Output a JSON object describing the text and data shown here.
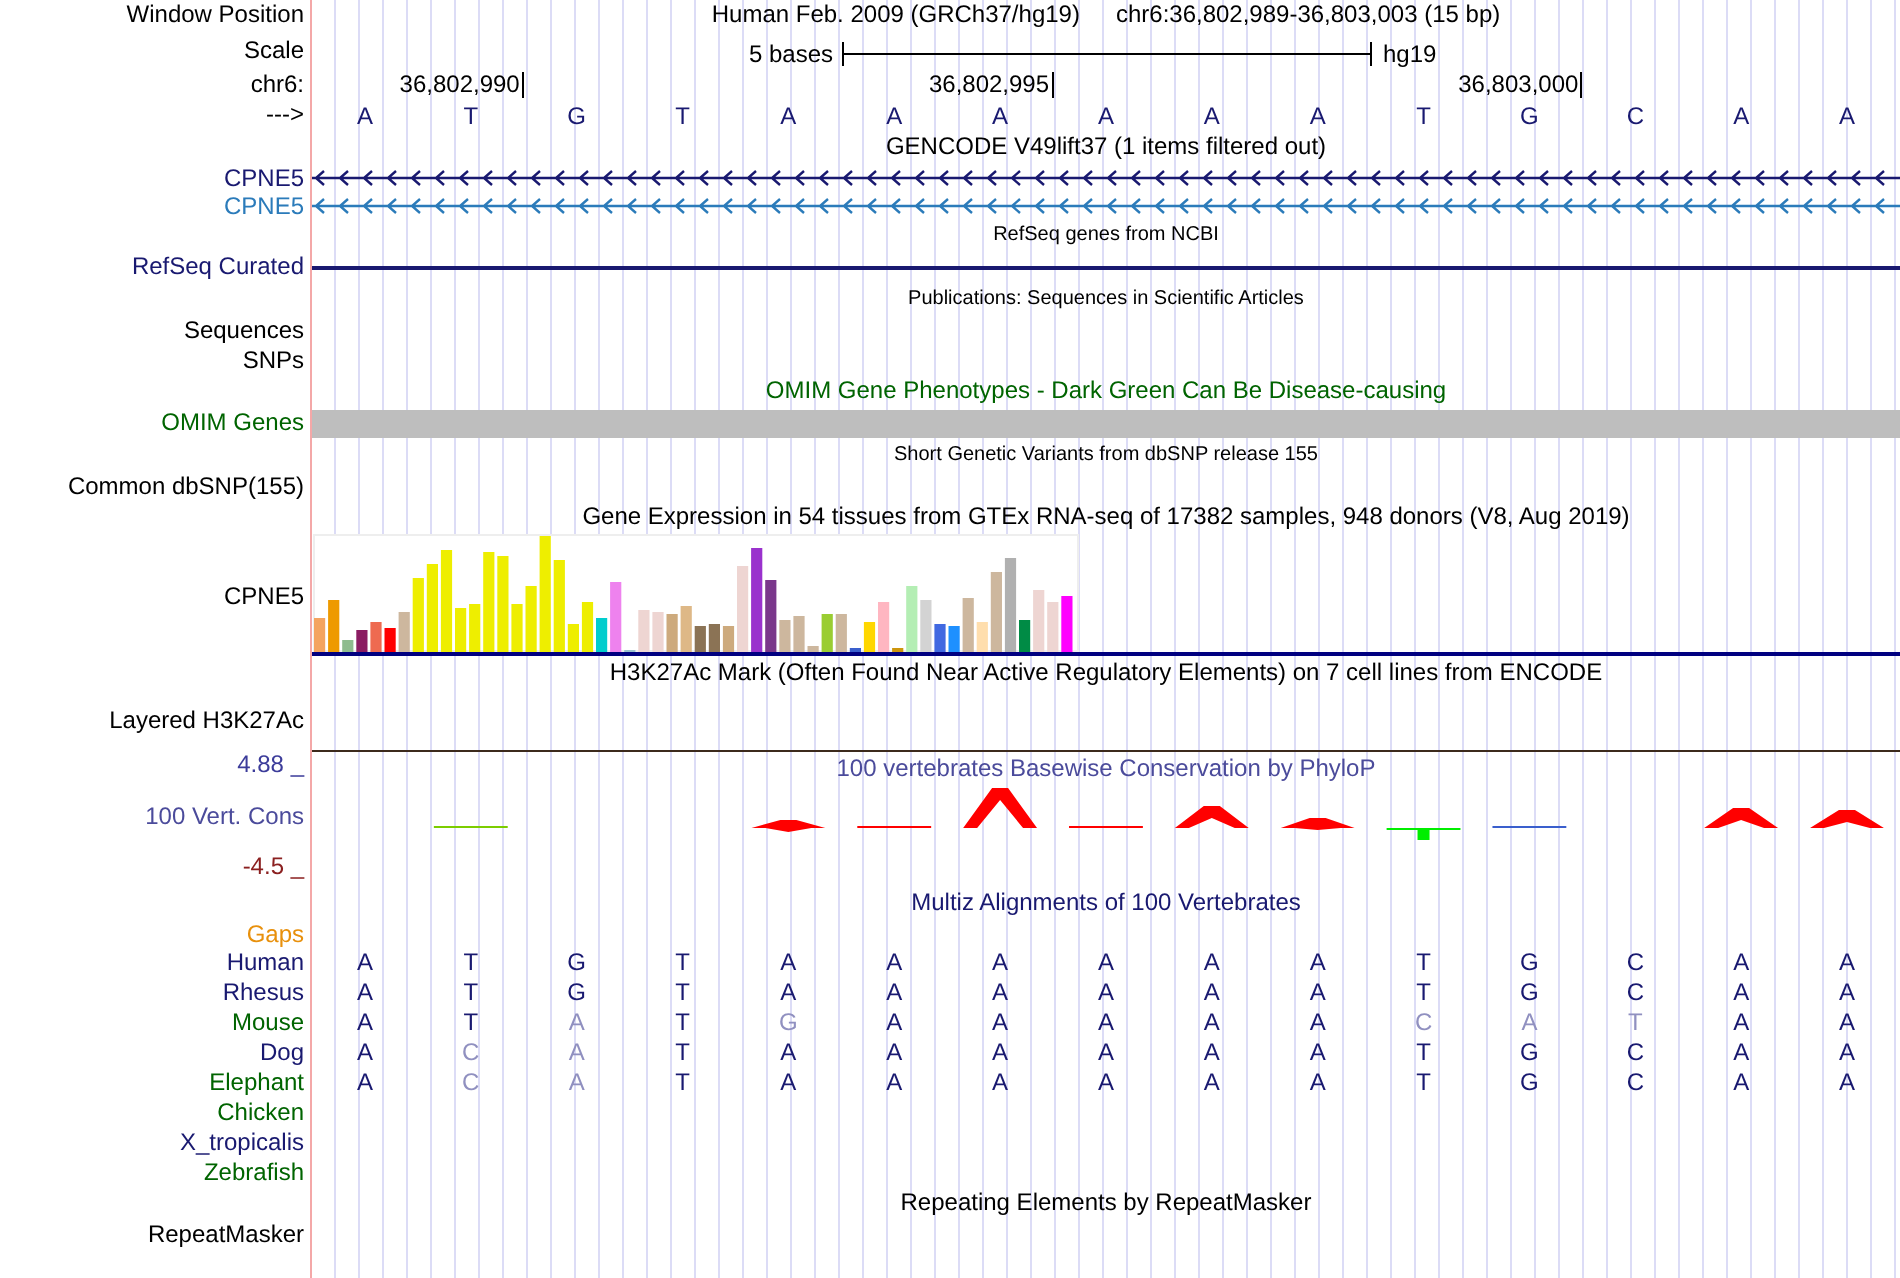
{
  "header": {
    "window_label": "Window Position",
    "assembly": "Human Feb. 2009 (GRCh37/hg19)",
    "position": "chr6:36,802,989-36,803,003 (15 bp)",
    "scale_label": "Scale",
    "scale_text": "5 bases",
    "scale_db": "hg19",
    "chrom_label": "chr6:",
    "positions": [
      "36,802,990",
      "36,802,995",
      "36,803,000"
    ],
    "strand_label": "--->",
    "bases": [
      "A",
      "T",
      "G",
      "T",
      "A",
      "A",
      "A",
      "A",
      "A",
      "A",
      "T",
      "G",
      "C",
      "A",
      "A"
    ]
  },
  "tracks": [
    {
      "kind": "title",
      "text": "GENCODE V49lift37 (1 items filtered out)"
    },
    {
      "kind": "gene",
      "label": "CPNE5",
      "color": "#191970"
    },
    {
      "kind": "gene",
      "label": "CPNE5",
      "color": "#2b7bba"
    },
    {
      "kind": "note",
      "text": "RefSeq genes from NCBI"
    },
    {
      "kind": "line",
      "label": "RefSeq Curated",
      "color": "#191970"
    },
    {
      "kind": "note",
      "text": "Publications: Sequences in Scientific Articles"
    },
    {
      "kind": "label",
      "label": "Sequences"
    },
    {
      "kind": "label",
      "label": "SNPs"
    },
    {
      "kind": "title",
      "text": "OMIM Gene Phenotypes - Dark Green Can Be Disease-causing",
      "color": "#006400"
    },
    {
      "kind": "bar",
      "label": "OMIM Genes",
      "color": "#006400"
    },
    {
      "kind": "note",
      "text": "Short Genetic Variants from dbSNP release 155"
    },
    {
      "kind": "label",
      "label": "Common dbSNP(155)"
    },
    {
      "kind": "title",
      "text": "Gene Expression in 54 tissues from GTEx RNA-seq of 17382 samples, 948 donors (V8, Aug 2019)"
    },
    {
      "kind": "expression",
      "label": "CPNE5"
    },
    {
      "kind": "title",
      "text": "H3K27Ac Mark (Often Found Near Active Regulatory Elements) on 7 cell lines from ENCODE"
    },
    {
      "kind": "layered",
      "label": "Layered H3K27Ac"
    },
    {
      "kind": "conservation",
      "label": "100 Vert. Cons",
      "max": "4.88 _",
      "min": "-4.5 _",
      "title": "100 vertebrates Basewise Conservation by PhyloP"
    },
    {
      "kind": "title",
      "text": "Multiz Alignments of 100 Vertebrates",
      "color": "#191970"
    },
    {
      "kind": "alignment",
      "gaps_label": "Gaps",
      "species": [
        {
          "name": "Human",
          "color": "#191970",
          "bases": [
            {
              "b": "A",
              "differs": false
            },
            {
              "b": "T",
              "differs": false
            },
            {
              "b": "G",
              "differs": false
            },
            {
              "b": "T",
              "differs": false
            },
            {
              "b": "A",
              "differs": false
            },
            {
              "b": "A",
              "differs": false
            },
            {
              "b": "A",
              "differs": false
            },
            {
              "b": "A",
              "differs": false
            },
            {
              "b": "A",
              "differs": false
            },
            {
              "b": "A",
              "differs": false
            },
            {
              "b": "T",
              "differs": false
            },
            {
              "b": "G",
              "differs": false
            },
            {
              "b": "C",
              "differs": false
            },
            {
              "b": "A",
              "differs": false
            },
            {
              "b": "A",
              "differs": false
            }
          ]
        },
        {
          "name": "Rhesus",
          "color": "#191970",
          "bases": [
            {
              "b": "A",
              "differs": false
            },
            {
              "b": "T",
              "differs": false
            },
            {
              "b": "G",
              "differs": false
            },
            {
              "b": "T",
              "differs": false
            },
            {
              "b": "A",
              "differs": false
            },
            {
              "b": "A",
              "differs": false
            },
            {
              "b": "A",
              "differs": false
            },
            {
              "b": "A",
              "differs": false
            },
            {
              "b": "A",
              "differs": false
            },
            {
              "b": "A",
              "differs": false
            },
            {
              "b": "T",
              "differs": false
            },
            {
              "b": "G",
              "differs": false
            },
            {
              "b": "C",
              "differs": false
            },
            {
              "b": "A",
              "differs": false
            },
            {
              "b": "A",
              "differs": false
            }
          ]
        },
        {
          "name": "Mouse",
          "color": "#006400",
          "bases": [
            {
              "b": "A",
              "differs": false
            },
            {
              "b": "T",
              "differs": false
            },
            {
              "b": "A",
              "differs": true
            },
            {
              "b": "T",
              "differs": false
            },
            {
              "b": "G",
              "differs": true
            },
            {
              "b": "A",
              "differs": false
            },
            {
              "b": "A",
              "differs": false
            },
            {
              "b": "A",
              "differs": false
            },
            {
              "b": "A",
              "differs": false
            },
            {
              "b": "A",
              "differs": false
            },
            {
              "b": "C",
              "differs": true
            },
            {
              "b": "A",
              "differs": true
            },
            {
              "b": "T",
              "differs": true
            },
            {
              "b": "A",
              "differs": false
            },
            {
              "b": "A",
              "differs": false
            }
          ]
        },
        {
          "name": "Dog",
          "color": "#191970",
          "bases": [
            {
              "b": "A",
              "differs": false
            },
            {
              "b": "C",
              "differs": true
            },
            {
              "b": "A",
              "differs": true
            },
            {
              "b": "T",
              "differs": false
            },
            {
              "b": "A",
              "differs": false
            },
            {
              "b": "A",
              "differs": false
            },
            {
              "b": "A",
              "differs": false
            },
            {
              "b": "A",
              "differs": false
            },
            {
              "b": "A",
              "differs": false
            },
            {
              "b": "A",
              "differs": false
            },
            {
              "b": "T",
              "differs": false
            },
            {
              "b": "G",
              "differs": false
            },
            {
              "b": "C",
              "differs": false
            },
            {
              "b": "A",
              "differs": false
            },
            {
              "b": "A",
              "differs": false
            }
          ]
        },
        {
          "name": "Elephant",
          "color": "#006400",
          "bases": [
            {
              "b": "A",
              "differs": false
            },
            {
              "b": "C",
              "differs": true
            },
            {
              "b": "A",
              "differs": true
            },
            {
              "b": "T",
              "differs": false
            },
            {
              "b": "A",
              "differs": false
            },
            {
              "b": "A",
              "differs": false
            },
            {
              "b": "A",
              "differs": false
            },
            {
              "b": "A",
              "differs": false
            },
            {
              "b": "A",
              "differs": false
            },
            {
              "b": "A",
              "differs": false
            },
            {
              "b": "T",
              "differs": false
            },
            {
              "b": "G",
              "differs": false
            },
            {
              "b": "C",
              "differs": false
            },
            {
              "b": "A",
              "differs": false
            },
            {
              "b": "A",
              "differs": false
            }
          ]
        },
        {
          "name": "Chicken",
          "color": "#006400"
        },
        {
          "name": "X_tropicalis",
          "color": "#191970"
        },
        {
          "name": "Zebrafish",
          "color": "#006400"
        }
      ]
    },
    {
      "kind": "title",
      "text": "Repeating Elements by RepeatMasker"
    },
    {
      "kind": "label",
      "label": "RepeatMasker"
    }
  ]
}
